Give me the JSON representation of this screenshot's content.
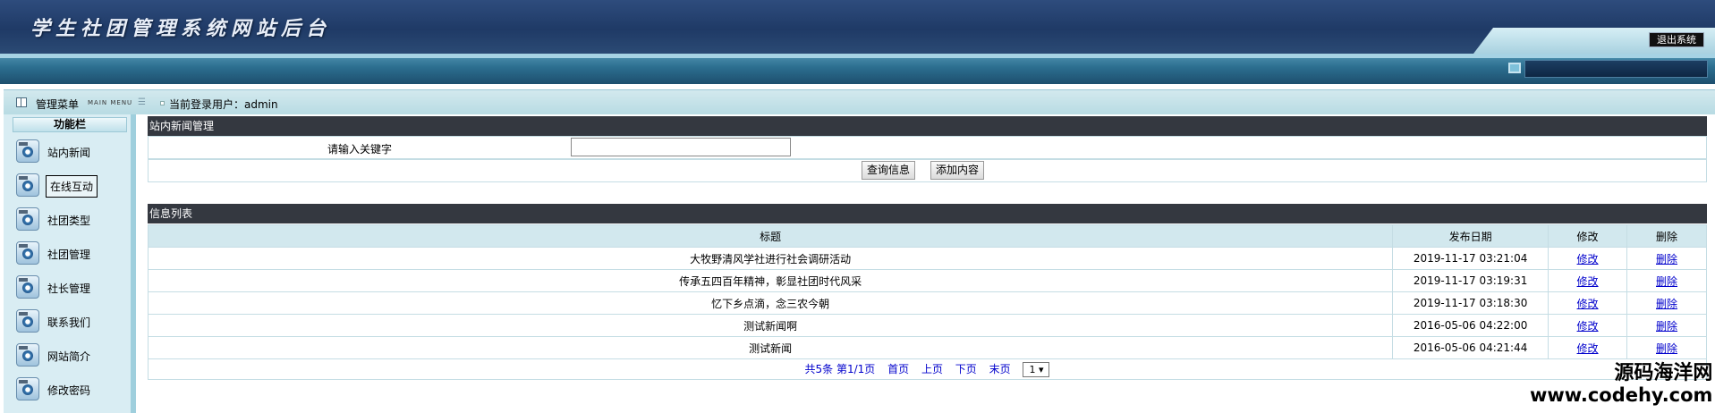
{
  "header": {
    "title": "学生社团管理系统网站后台",
    "logout_label": "退出系统"
  },
  "menubar": {
    "title": "管理菜单",
    "subtitle": "MAIN MENU",
    "user_label": "当前登录用户：admin"
  },
  "sidebar": {
    "header": "功能栏",
    "items": [
      {
        "label": "站内新闻",
        "icon": "settings-gear-icon"
      },
      {
        "label": "在线互动",
        "icon": "settings-gear-icon"
      },
      {
        "label": "社团类型",
        "icon": "settings-gear-icon"
      },
      {
        "label": "社团管理",
        "icon": "settings-gear-icon"
      },
      {
        "label": "社长管理",
        "icon": "settings-gear-icon"
      },
      {
        "label": "联系我们",
        "icon": "settings-gear-icon"
      },
      {
        "label": "网站简介",
        "icon": "settings-gear-icon"
      },
      {
        "label": "修改密码",
        "icon": "settings-gear-icon"
      }
    ]
  },
  "search": {
    "section_title": "站内新闻管理",
    "keyword_label": "请输入关键字",
    "keyword_value": "",
    "query_button": "查询信息",
    "add_button": "添加内容"
  },
  "list": {
    "section_title": "信息列表",
    "columns": [
      "标题",
      "发布日期",
      "修改",
      "删除"
    ],
    "rows": [
      {
        "title": "大牧野清风学社进行社会调研活动",
        "date": "2019-11-17 03:21:04",
        "edit": "修改",
        "delete": "删除"
      },
      {
        "title": "传承五四百年精神，彰显社团时代风采",
        "date": "2019-11-17 03:19:31",
        "edit": "修改",
        "delete": "删除"
      },
      {
        "title": "忆下乡点滴，念三农今朝",
        "date": "2019-11-17 03:18:30",
        "edit": "修改",
        "delete": "删除"
      },
      {
        "title": "测试新闻啊",
        "date": "2016-05-06 04:22:00",
        "edit": "修改",
        "delete": "删除"
      },
      {
        "title": "测试新闻",
        "date": "2016-05-06 04:21:44",
        "edit": "修改",
        "delete": "删除"
      }
    ]
  },
  "pager": {
    "summary": "共5条 第1/1页",
    "first": "首页",
    "prev": "上页",
    "next": "下页",
    "last": "末页",
    "page_select": "1 ▾"
  },
  "watermark": {
    "line1": "源码海洋网",
    "line2": "www.codehy.com"
  },
  "colors": {
    "header_bg": "#1f3a66",
    "section_header_bg": "#343840",
    "table_header_bg": "#d2e8ee",
    "link": "#0000cc"
  }
}
